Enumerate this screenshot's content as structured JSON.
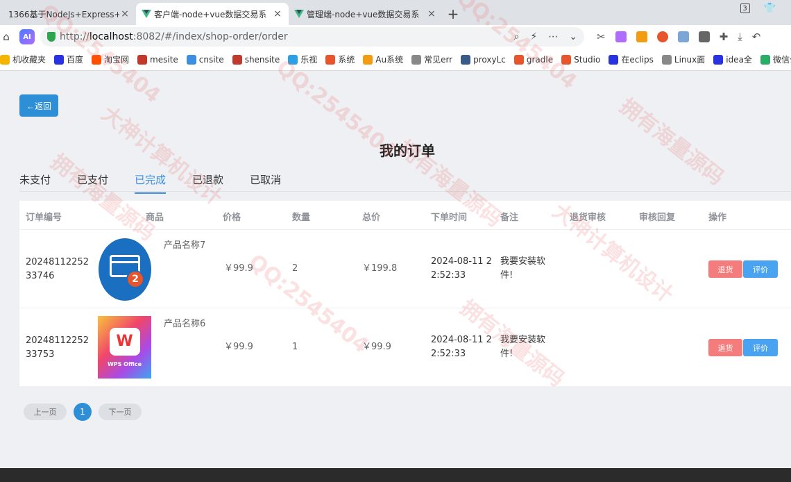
{
  "tabs": [
    {
      "title": "1366基于NodeJs+Express+",
      "close": "×"
    },
    {
      "title": "客户端-node+vue数据交易系",
      "close": "×"
    },
    {
      "title": "管理端-node+vue数据交易系",
      "close": "×"
    }
  ],
  "new_tab": "+",
  "tab_count": "3",
  "address": {
    "url_prefix": "http://",
    "url_host": "localhost",
    "url_rest": ":8082/#/index/shop-order/order",
    "ai_label": "AI"
  },
  "bookmarks": [
    {
      "label": "机收藏夹",
      "color": "#f5b400"
    },
    {
      "label": "百度",
      "color": "#2932e1"
    },
    {
      "label": "淘宝网",
      "color": "#ff5000"
    },
    {
      "label": "mesite",
      "color": "#c0392b"
    },
    {
      "label": "cnsite",
      "color": "#3b8ee0"
    },
    {
      "label": "shensite",
      "color": "#c0392b"
    },
    {
      "label": "乐视",
      "color": "#2aa0e6"
    },
    {
      "label": "系统",
      "color": "#e8542b"
    },
    {
      "label": "Au系统",
      "color": "#f39c12"
    },
    {
      "label": "常见err",
      "color": "#888888"
    },
    {
      "label": "proxyLc",
      "color": "#3a5a8a"
    },
    {
      "label": "gradle",
      "color": "#e8542b"
    },
    {
      "label": "Studio",
      "color": "#e8542b"
    },
    {
      "label": "在eclips",
      "color": "#2932e1"
    },
    {
      "label": "Linux面",
      "color": "#888888"
    },
    {
      "label": "idea全",
      "color": "#2932e1"
    },
    {
      "label": "微信公",
      "color": "#2aae67"
    }
  ],
  "page": {
    "back_label": "←返回",
    "title": "我的订单",
    "status_tabs": [
      "未支付",
      "已支付",
      "已完成",
      "已退款",
      "已取消"
    ],
    "active_tab": "已完成",
    "columns": [
      "订单编号",
      "商品",
      "价格",
      "数量",
      "总价",
      "下单时间",
      "备注",
      "退货审核",
      "审核回复",
      "操作"
    ],
    "orders": [
      {
        "order_no_1": "20248112252",
        "order_no_2": "33746",
        "product_name": "产品名称7",
        "price": "￥99.9",
        "qty": "2",
        "total": "￥199.8",
        "time_1": "2024-08-11 2",
        "time_2": "2:52:33",
        "note_1": "我要安装软",
        "note_2": "件!",
        "review_status": "",
        "review_reply": "",
        "img_badge": "2",
        "refund_label": "退货",
        "rate_label": "评价"
      },
      {
        "order_no_1": "20248112252",
        "order_no_2": "33753",
        "product_name": "产品名称6",
        "price": "￥99.9",
        "qty": "1",
        "total": "￥99.9",
        "time_1": "2024-08-11 2",
        "time_2": "2:52:33",
        "note_1": "我要安装软",
        "note_2": "件!",
        "review_status": "",
        "review_reply": "",
        "img_logo": "W",
        "img_label": "WPS Office",
        "refund_label": "退货",
        "rate_label": "评价"
      }
    ],
    "pager": {
      "prev": "上一页",
      "current": "1",
      "next": "下一页"
    }
  },
  "watermarks": [
    "QQ:2545404",
    "拥有海量源码",
    "大神计算机设计",
    "QQ:2545404",
    "拥有海量源码",
    "QQ:2545404",
    "大神计算机设计",
    "拥有海量源码",
    "QQ:2545404",
    "拥有海量源码"
  ],
  "colors": {
    "accent": "#2e8fd6",
    "refund": "#f47c7c",
    "review": "#4aa3f0",
    "active_tab": "#3a8ee6"
  }
}
